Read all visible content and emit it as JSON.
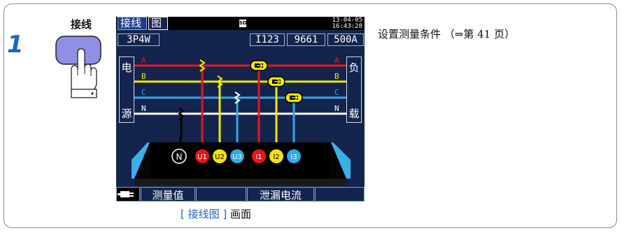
{
  "step": {
    "number": "1",
    "key_label": "接线"
  },
  "screen": {
    "header": {
      "tab_active": "接线",
      "tab_other": "图",
      "sd_label": "SD",
      "date": "13-04-05",
      "time": "16:43:28"
    },
    "info": {
      "wiring": "3P4W",
      "channels": "I123",
      "sensor": "9661",
      "range": "500A"
    },
    "source_label": {
      "top": "电",
      "bottom": "源"
    },
    "load_label": {
      "top": "负",
      "bottom": "载"
    },
    "lines": {
      "a": "A",
      "b": "B",
      "c": "C",
      "n": "N"
    },
    "terminals": {
      "n": "N",
      "u1": "U1",
      "u2": "U2",
      "u3": "U3",
      "i1": "I1",
      "i2": "I2",
      "i3": "I3"
    },
    "bottom_bar": {
      "measure": "测量值",
      "leakage": "泄漏电流"
    }
  },
  "caption": {
    "bracket_open": "[ ",
    "name": "接线图",
    "bracket_close": " ]",
    "suffix": " 画面"
  },
  "description": "设置测量条件 （⇒第 41 页）",
  "colors": {
    "red": "#e8141c",
    "yellow": "#f4e600",
    "blue": "#32a8e8",
    "white": "#ffffff",
    "accent": "#1c63c9",
    "screen_bg": "#13254d"
  }
}
